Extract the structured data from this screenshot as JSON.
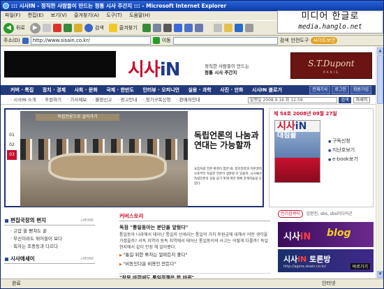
{
  "window": {
    "title": "::: 시사IN - 정직한 사람들이 만드는 정통 시사 주간지 ::: - Microsoft Internet Explorer"
  },
  "watermark": {
    "line1": "미디어 한글로",
    "line2": "media.hanglo.net"
  },
  "menu": [
    "파일(F)",
    "편집(E)",
    "보기(V)",
    "즐겨찾기(A)",
    "도구(T)",
    "도움말(H)"
  ],
  "toolbar": {
    "back": "뒤로",
    "search": "검색",
    "favorites": "즐겨찾기"
  },
  "address": {
    "label": "주소(D)",
    "url": "http://www.sisain.co.kr/",
    "go": "이동",
    "search2": "검색",
    "safe": "안전도구",
    "site": "사이트보안"
  },
  "site": {
    "logo_main": "시사",
    "logo_in": "iN",
    "slogan_line1": "정직한 사람들이 만드는",
    "slogan_line2": "정통 시사 주간지",
    "ad_brand": "S.T.Dupont",
    "ad_sub": "PARIS",
    "nav_main": [
      "커버 · 특집",
      "정치 · 경제",
      "사회 · 문화",
      "국제 · 한반도",
      "인터뷰 · 오피니언",
      "실용 · 과학",
      "사진 · 만화",
      "시사IN 블로거"
    ],
    "nav_right": [
      "전체기사",
      "로그인",
      "회원가입"
    ],
    "nav_sub": [
      "· 시사IN 소개",
      "· 후원하기",
      "· 기사제보",
      "· 불편신고",
      "· 광고안내",
      "· 정기구독신청",
      "· 판매처안내"
    ],
    "search_placeholder": "발행일 2008.9.16 화 12:59",
    "search_btn": "검색",
    "search_adv": "자세히"
  },
  "feature": {
    "banner": "독립언론으로 살아가기",
    "headline": "독립언론의 나눔과 연대는 가능할까",
    "desc": "요즘처럼 언론 환경이 험한 때, 정치권력과 자본권력으로부터 독립한 언론이 생존할 수 있을까. 시사IN은 독립언론의 길을 묻기 위해 여러 매체 관계자들을 모았다.",
    "nums": [
      "01",
      "02",
      "03"
    ]
  },
  "magazine": {
    "issue": "제 54호 2008년 09월 27일",
    "cover_logo": "시사",
    "cover_in": "iN",
    "cover_head": "대침몰",
    "links": [
      "구독신청",
      "지난호보기",
      "e-book보기"
    ]
  },
  "left": {
    "section1": "편집국장의 편지",
    "more": "+MORE",
    "items1": [
      "고맙 을 뻗쳐도 끝",
      "무신이라도 뛰어들어 보다",
      "독자는 조중동과 다르다"
    ],
    "section2": "시사에세이",
    "more2": "+MORE"
  },
  "middle": {
    "header": "커버스토리",
    "title": "독점 \"통일동아는 분단을 앞뒀다\"",
    "body": "통일동아 나라에서 태어난 통일의 산세라는 통일의 가치 후원금에 대해서 어떤 생각을 가졌을까? 서독 지역과 동독 지역에서 태어난 통일동이의 사고는 어떻게 다를까? 독일 현지에서 같이 인정 해 알아봤다.",
    "links": [
      "\"통일 위한 투자는 얼마든지 좋다\"",
      "\"비동인다운 비용인 만든다\""
    ],
    "bottom": "\"창문 바깥에도 통일정책은 한 바퀴\""
  },
  "right": {
    "tag": "인기검색어",
    "keywords": "김현진, sbs, sbs미디어군",
    "blog_brand": "시사",
    "blog_in": "iN",
    "blog_word": "blog",
    "talk_brand": "시사",
    "talk_in": "iN",
    "talk_word": "토론방",
    "talk_url": "http://agora.sisain.co.kr/",
    "talk_go": "바로가기"
  },
  "status": {
    "left": "완료",
    "zone": "인터넷"
  }
}
